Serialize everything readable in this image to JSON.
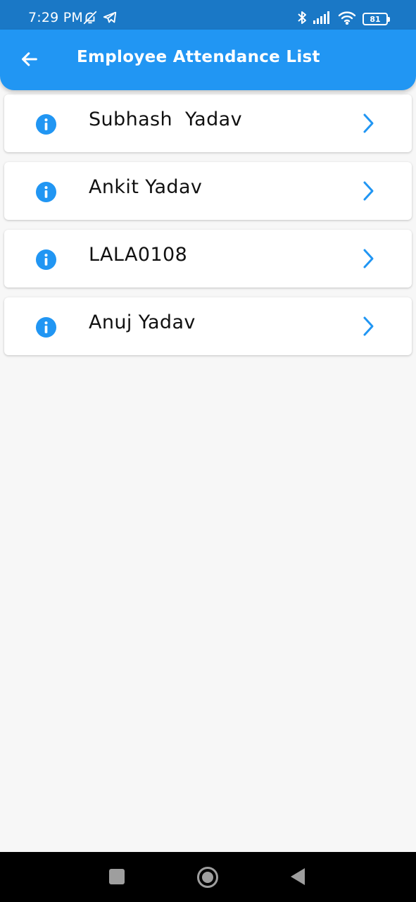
{
  "status_bar": {
    "time": "7:29 PM",
    "icons_left": [
      "bell-off-icon",
      "telegram-icon"
    ],
    "icons_right": [
      "bluetooth-icon",
      "signal-icon",
      "wifi-icon"
    ],
    "battery": "81"
  },
  "app_bar": {
    "title": "Employee Attendance List",
    "back_icon": "arrow-left-icon",
    "background": "#2196f3"
  },
  "employees": [
    {
      "name": "Subhash  Yadav"
    },
    {
      "name": "Ankit Yadav"
    },
    {
      "name": "LALA0108"
    },
    {
      "name": "Anuj Yadav"
    }
  ],
  "row_icons": {
    "leading": "info-icon",
    "trailing": "chevron-right-icon",
    "color": "#2196f3"
  },
  "nav_bar": {
    "buttons": [
      "recents-button",
      "home-button",
      "back-button"
    ]
  }
}
